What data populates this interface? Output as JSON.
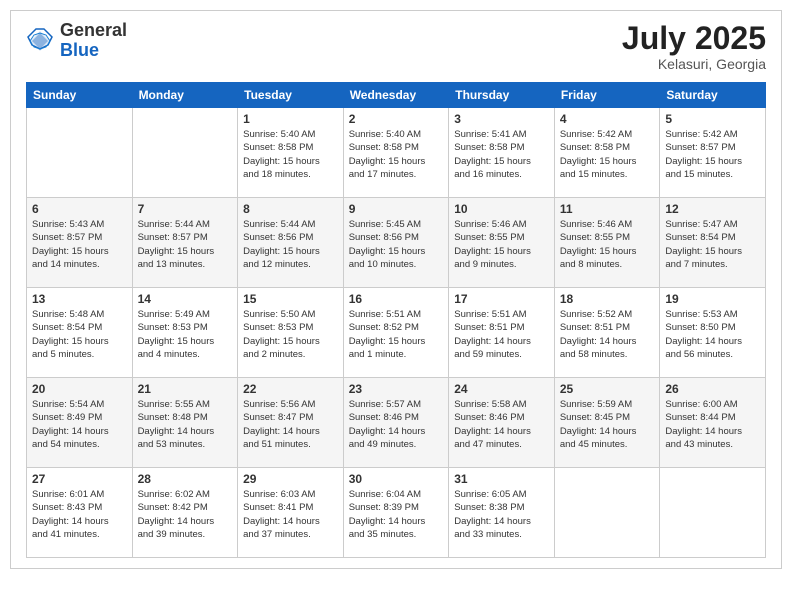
{
  "header": {
    "logo_general": "General",
    "logo_blue": "Blue",
    "month_title": "July 2025",
    "location": "Kelasuri, Georgia"
  },
  "days_of_week": [
    "Sunday",
    "Monday",
    "Tuesday",
    "Wednesday",
    "Thursday",
    "Friday",
    "Saturday"
  ],
  "weeks": [
    [
      {
        "day": "",
        "sunrise": "",
        "sunset": "",
        "daylight": ""
      },
      {
        "day": "",
        "sunrise": "",
        "sunset": "",
        "daylight": ""
      },
      {
        "day": "1",
        "sunrise": "Sunrise: 5:40 AM",
        "sunset": "Sunset: 8:58 PM",
        "daylight": "Daylight: 15 hours and 18 minutes."
      },
      {
        "day": "2",
        "sunrise": "Sunrise: 5:40 AM",
        "sunset": "Sunset: 8:58 PM",
        "daylight": "Daylight: 15 hours and 17 minutes."
      },
      {
        "day": "3",
        "sunrise": "Sunrise: 5:41 AM",
        "sunset": "Sunset: 8:58 PM",
        "daylight": "Daylight: 15 hours and 16 minutes."
      },
      {
        "day": "4",
        "sunrise": "Sunrise: 5:42 AM",
        "sunset": "Sunset: 8:58 PM",
        "daylight": "Daylight: 15 hours and 15 minutes."
      },
      {
        "day": "5",
        "sunrise": "Sunrise: 5:42 AM",
        "sunset": "Sunset: 8:57 PM",
        "daylight": "Daylight: 15 hours and 15 minutes."
      }
    ],
    [
      {
        "day": "6",
        "sunrise": "Sunrise: 5:43 AM",
        "sunset": "Sunset: 8:57 PM",
        "daylight": "Daylight: 15 hours and 14 minutes."
      },
      {
        "day": "7",
        "sunrise": "Sunrise: 5:44 AM",
        "sunset": "Sunset: 8:57 PM",
        "daylight": "Daylight: 15 hours and 13 minutes."
      },
      {
        "day": "8",
        "sunrise": "Sunrise: 5:44 AM",
        "sunset": "Sunset: 8:56 PM",
        "daylight": "Daylight: 15 hours and 12 minutes."
      },
      {
        "day": "9",
        "sunrise": "Sunrise: 5:45 AM",
        "sunset": "Sunset: 8:56 PM",
        "daylight": "Daylight: 15 hours and 10 minutes."
      },
      {
        "day": "10",
        "sunrise": "Sunrise: 5:46 AM",
        "sunset": "Sunset: 8:55 PM",
        "daylight": "Daylight: 15 hours and 9 minutes."
      },
      {
        "day": "11",
        "sunrise": "Sunrise: 5:46 AM",
        "sunset": "Sunset: 8:55 PM",
        "daylight": "Daylight: 15 hours and 8 minutes."
      },
      {
        "day": "12",
        "sunrise": "Sunrise: 5:47 AM",
        "sunset": "Sunset: 8:54 PM",
        "daylight": "Daylight: 15 hours and 7 minutes."
      }
    ],
    [
      {
        "day": "13",
        "sunrise": "Sunrise: 5:48 AM",
        "sunset": "Sunset: 8:54 PM",
        "daylight": "Daylight: 15 hours and 5 minutes."
      },
      {
        "day": "14",
        "sunrise": "Sunrise: 5:49 AM",
        "sunset": "Sunset: 8:53 PM",
        "daylight": "Daylight: 15 hours and 4 minutes."
      },
      {
        "day": "15",
        "sunrise": "Sunrise: 5:50 AM",
        "sunset": "Sunset: 8:53 PM",
        "daylight": "Daylight: 15 hours and 2 minutes."
      },
      {
        "day": "16",
        "sunrise": "Sunrise: 5:51 AM",
        "sunset": "Sunset: 8:52 PM",
        "daylight": "Daylight: 15 hours and 1 minute."
      },
      {
        "day": "17",
        "sunrise": "Sunrise: 5:51 AM",
        "sunset": "Sunset: 8:51 PM",
        "daylight": "Daylight: 14 hours and 59 minutes."
      },
      {
        "day": "18",
        "sunrise": "Sunrise: 5:52 AM",
        "sunset": "Sunset: 8:51 PM",
        "daylight": "Daylight: 14 hours and 58 minutes."
      },
      {
        "day": "19",
        "sunrise": "Sunrise: 5:53 AM",
        "sunset": "Sunset: 8:50 PM",
        "daylight": "Daylight: 14 hours and 56 minutes."
      }
    ],
    [
      {
        "day": "20",
        "sunrise": "Sunrise: 5:54 AM",
        "sunset": "Sunset: 8:49 PM",
        "daylight": "Daylight: 14 hours and 54 minutes."
      },
      {
        "day": "21",
        "sunrise": "Sunrise: 5:55 AM",
        "sunset": "Sunset: 8:48 PM",
        "daylight": "Daylight: 14 hours and 53 minutes."
      },
      {
        "day": "22",
        "sunrise": "Sunrise: 5:56 AM",
        "sunset": "Sunset: 8:47 PM",
        "daylight": "Daylight: 14 hours and 51 minutes."
      },
      {
        "day": "23",
        "sunrise": "Sunrise: 5:57 AM",
        "sunset": "Sunset: 8:46 PM",
        "daylight": "Daylight: 14 hours and 49 minutes."
      },
      {
        "day": "24",
        "sunrise": "Sunrise: 5:58 AM",
        "sunset": "Sunset: 8:46 PM",
        "daylight": "Daylight: 14 hours and 47 minutes."
      },
      {
        "day": "25",
        "sunrise": "Sunrise: 5:59 AM",
        "sunset": "Sunset: 8:45 PM",
        "daylight": "Daylight: 14 hours and 45 minutes."
      },
      {
        "day": "26",
        "sunrise": "Sunrise: 6:00 AM",
        "sunset": "Sunset: 8:44 PM",
        "daylight": "Daylight: 14 hours and 43 minutes."
      }
    ],
    [
      {
        "day": "27",
        "sunrise": "Sunrise: 6:01 AM",
        "sunset": "Sunset: 8:43 PM",
        "daylight": "Daylight: 14 hours and 41 minutes."
      },
      {
        "day": "28",
        "sunrise": "Sunrise: 6:02 AM",
        "sunset": "Sunset: 8:42 PM",
        "daylight": "Daylight: 14 hours and 39 minutes."
      },
      {
        "day": "29",
        "sunrise": "Sunrise: 6:03 AM",
        "sunset": "Sunset: 8:41 PM",
        "daylight": "Daylight: 14 hours and 37 minutes."
      },
      {
        "day": "30",
        "sunrise": "Sunrise: 6:04 AM",
        "sunset": "Sunset: 8:39 PM",
        "daylight": "Daylight: 14 hours and 35 minutes."
      },
      {
        "day": "31",
        "sunrise": "Sunrise: 6:05 AM",
        "sunset": "Sunset: 8:38 PM",
        "daylight": "Daylight: 14 hours and 33 minutes."
      },
      {
        "day": "",
        "sunrise": "",
        "sunset": "",
        "daylight": ""
      },
      {
        "day": "",
        "sunrise": "",
        "sunset": "",
        "daylight": ""
      }
    ]
  ]
}
